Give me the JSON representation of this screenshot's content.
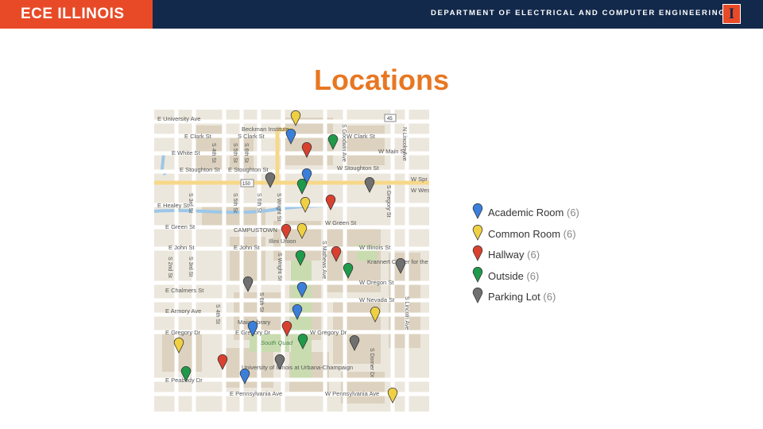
{
  "header": {
    "brand": "ECE ILLINOIS",
    "department": "DEPARTMENT OF ELECTRICAL AND COMPUTER ENGINEERING",
    "logo_letter": "I",
    "brand_color": "#e84a27",
    "bar_color": "#13294b"
  },
  "title": "Locations",
  "map": {
    "street_labels": [
      "E University Ave",
      "Beckman Institute",
      "E Clark St",
      "S Clark St",
      "W Clark St",
      "E White St",
      "W Main St",
      "E Stoughton St",
      "W Stoughton St",
      "E Healey St",
      "E Green St",
      "W Green St",
      "CAMPUSTOWN",
      "Illini Union",
      "E John St",
      "W Illinois St",
      "Krannert Center for the Performing Arts",
      "E Chalmers St",
      "W Oregon St",
      "W Nevada St",
      "E Armory Ave",
      "Main Library",
      "E Gregory Dr",
      "W Gregory Dr",
      "South Quad",
      "University of Illinois at Urbana-Champaign",
      "E Peabody Dr",
      "E Pennsylvania Ave",
      "W Pennsylvania Ave",
      "S 4th St",
      "S 5th St",
      "S 6th St",
      "S Wright St",
      "S Mathews Ave",
      "S Goodwin Ave",
      "S Gregory St",
      "N Lincoln Ave",
      "S Lincoln Ave",
      "S Dorner Dr",
      "S 2nd St",
      "S 3rd St",
      "W Spr",
      "W West",
      "45",
      "150"
    ],
    "pin_colors": {
      "academic": "#3b7fdb",
      "common": "#f0d043",
      "hallway": "#d9412f",
      "outside": "#1f9a4a",
      "parking": "#707070"
    }
  },
  "legend": [
    {
      "label": "Academic Room",
      "count": "(6)",
      "category": "academic"
    },
    {
      "label": "Common Room",
      "count": "(6)",
      "category": "common"
    },
    {
      "label": "Hallway",
      "count": "(6)",
      "category": "hallway"
    },
    {
      "label": "Outside",
      "count": "(6)",
      "category": "outside"
    },
    {
      "label": "Parking Lot",
      "count": "(6)",
      "category": "parking"
    }
  ]
}
